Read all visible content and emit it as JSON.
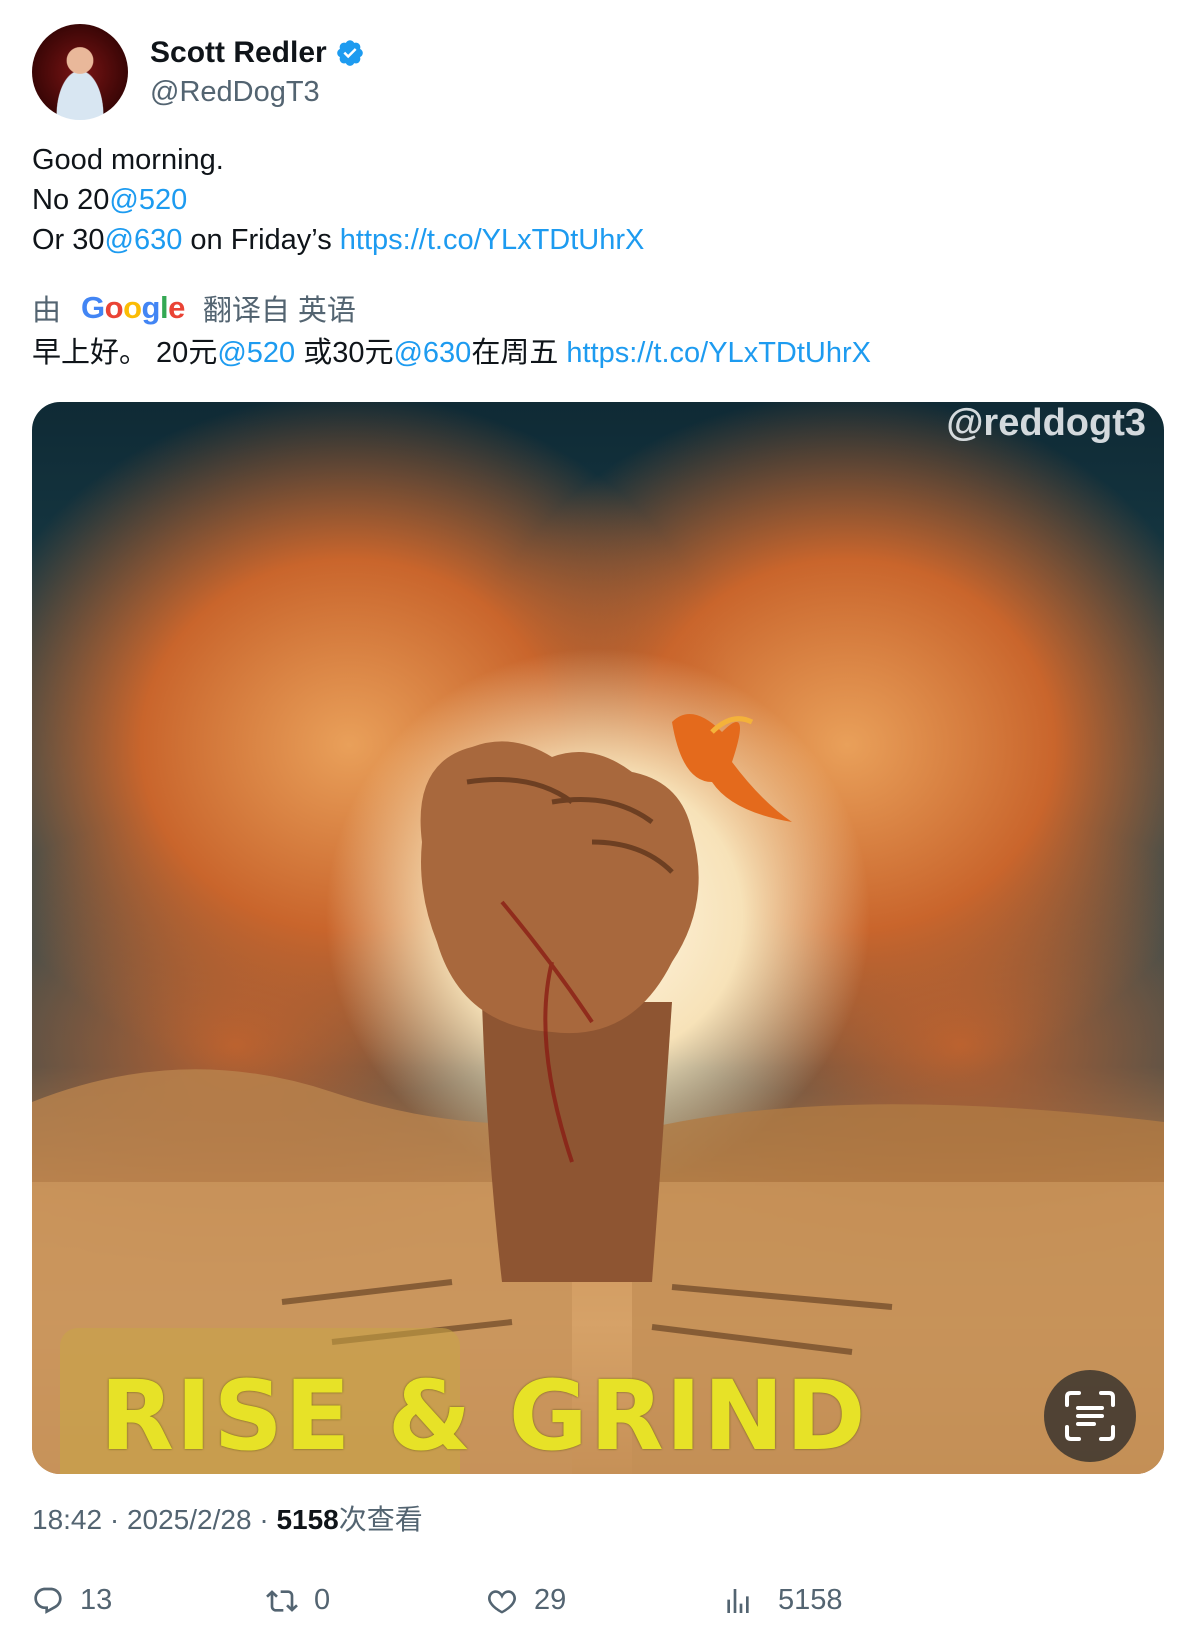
{
  "user": {
    "display_name": "Scott Redler",
    "handle": "@RedDogT3"
  },
  "tweet": {
    "line1": "Good morning.",
    "line2_prefix": "No 20",
    "line2_mention": "@520",
    "line3_prefix": "Or 30",
    "line3_mention": "@630",
    "line3_middle": " on Friday’s ",
    "line3_link": "https://t.co/YLxTDtUhrX"
  },
  "translation": {
    "prefix": "由",
    "provider": "Google",
    "suffix": "翻译自 英语",
    "text_1": "早上好。 20元",
    "mention_1": "@520",
    "text_2": " 或30元",
    "mention_2": "@630",
    "text_3": "在周五 ",
    "link": "https://t.co/YLxTDtUhrX"
  },
  "media": {
    "watermark": "@reddogt3",
    "banner": "RISE & GRIND"
  },
  "meta": {
    "time": "18:42",
    "separator": " · ",
    "date": "2025/2/28",
    "views": "5158",
    "views_label": "次查看"
  },
  "actions": {
    "replies": "13",
    "reposts": "0",
    "likes": "29",
    "views": "5158"
  },
  "colors": {
    "link": "#1d9bf0",
    "secondary_text": "#536471",
    "verified": "#1d9bf0"
  }
}
